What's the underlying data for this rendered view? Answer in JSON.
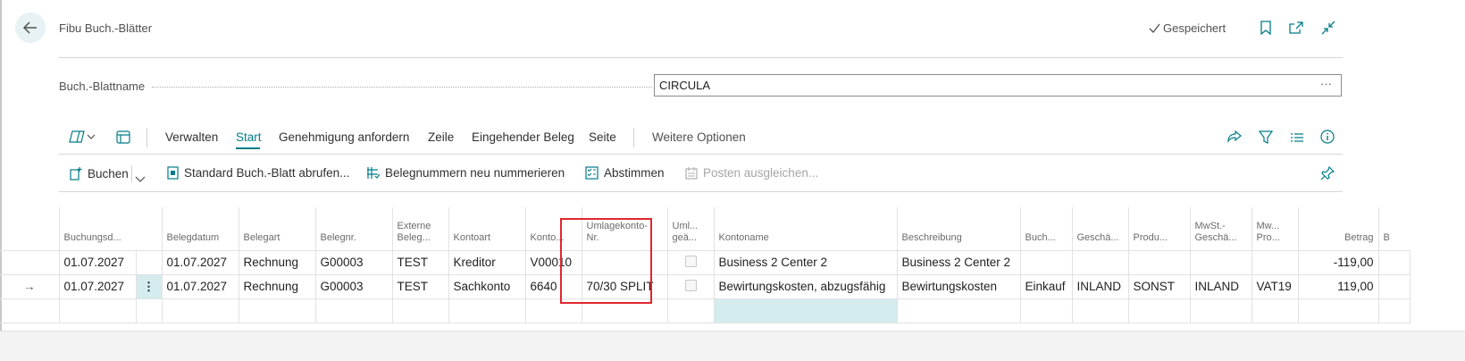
{
  "header": {
    "title": "Fibu Buch.-Blätter",
    "saved_label": "Gespeichert"
  },
  "field": {
    "label": "Buch.-Blattname",
    "value": "CIRCULA",
    "ellipsis": "···"
  },
  "actions": {
    "verwalten": "Verwalten",
    "start": "Start",
    "genehmigung": "Genehmigung anfordern",
    "zeile": "Zeile",
    "eingehender_beleg": "Eingehender Beleg",
    "seite": "Seite",
    "weitere": "Weitere Optionen"
  },
  "sub_actions": {
    "buchen": "Buchen",
    "standard": "Standard Buch.-Blatt abrufen...",
    "belegnummern": "Belegnummern neu nummerieren",
    "abstimmen": "Abstimmen",
    "posten": "Posten ausgleichen..."
  },
  "columns": {
    "buchungsdatum": "Buchungsd...",
    "belegdatum": "Belegdatum",
    "belegart": "Belegart",
    "belegnr": "Belegnr.",
    "externe1": "Externe",
    "externe2": "Beleg...",
    "kontoart": "Kontoart",
    "konto": "Konto...",
    "umlage1": "Umlagekonto-",
    "umlage2": "Nr.",
    "uml1": "Uml...",
    "uml2": "geä...",
    "kontoname": "Kontoname",
    "beschreibung": "Beschreibung",
    "buch": "Buch...",
    "gesch": "Geschä...",
    "produ": "Produ...",
    "mwst1": "MwSt.-",
    "mwst2": "Geschä...",
    "mw1": "Mw...",
    "mw2": "Pro...",
    "betrag": "Betrag",
    "extra": "B"
  },
  "rows": [
    {
      "buchungsdatum": "01.07.2027",
      "belegdatum": "01.07.2027",
      "belegart": "Rechnung",
      "belegnr": "G00003",
      "externe": "TEST",
      "kontoart": "Kreditor",
      "konto": "V00010",
      "umlage": "",
      "kontoname": "Business 2 Center 2",
      "beschreibung": "Business 2 Center 2",
      "buch": "",
      "gesch": "",
      "produ": "",
      "mwst": "",
      "mw": "",
      "betrag": "-119,00"
    },
    {
      "buchungsdatum": "01.07.2027",
      "belegdatum": "01.07.2027",
      "belegart": "Rechnung",
      "belegnr": "G00003",
      "externe": "TEST",
      "kontoart": "Sachkonto",
      "konto": "6640",
      "umlage": "70/30 SPLIT",
      "kontoname": "Bewirtungskosten, abzugsfähig",
      "beschreibung": "Bewirtungskosten",
      "buch": "Einkauf",
      "gesch": "INLAND",
      "produ": "SONST",
      "mwst": "INLAND",
      "mw": "VAT19",
      "betrag": "119,00"
    }
  ],
  "row_marker": "→",
  "row_menu": "⋮",
  "colors": {
    "accent": "#007c87",
    "highlight": "#e0262e",
    "selection": "#d4ecee"
  }
}
